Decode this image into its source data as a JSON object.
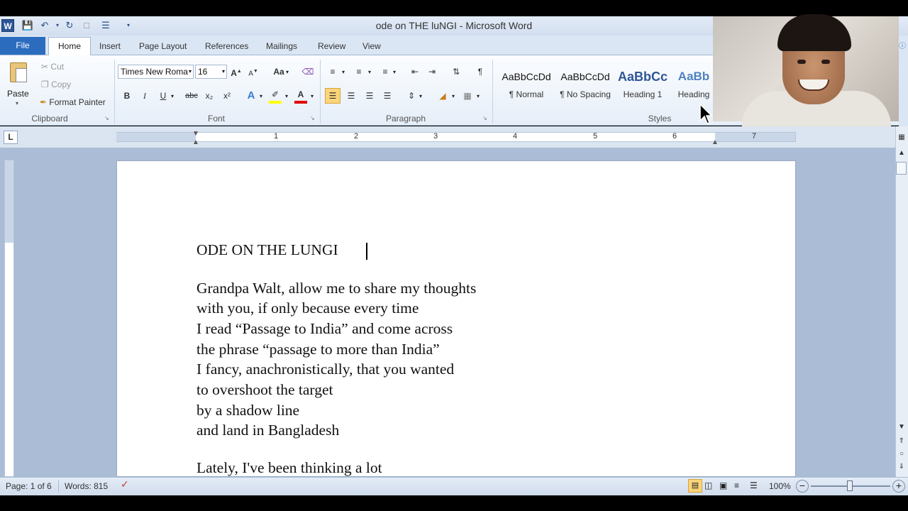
{
  "window": {
    "title": "ode on THE luNGI  -  Microsoft Word",
    "app_icon": "W"
  },
  "quick_access": [
    "save-icon",
    "undo-icon",
    "dropdown-icon",
    "redo-icon",
    "new-icon",
    "customize-icon",
    "more-icon"
  ],
  "tabs": [
    "File",
    "Home",
    "Insert",
    "Page Layout",
    "References",
    "Mailings",
    "Review",
    "View"
  ],
  "clipboard": {
    "paste": "Paste",
    "cut": "Cut",
    "copy": "Copy",
    "format_painter": "Format Painter",
    "label": "Clipboard"
  },
  "font": {
    "family": "Times New Roma",
    "size": "16",
    "label": "Font",
    "grow": "A",
    "shrink": "A",
    "case": "Aa",
    "bold": "B",
    "italic": "I",
    "underline": "U",
    "strike": "abc",
    "subscript": "x₂",
    "superscript": "x²",
    "text_effects": "A",
    "font_color": "A"
  },
  "paragraph": {
    "label": "Paragraph",
    "show_marks": "¶"
  },
  "styles": {
    "label": "Styles",
    "items": [
      {
        "sample": "AaBbCcDd",
        "name": "¶ Normal"
      },
      {
        "sample": "AaBbCcDd",
        "name": "¶ No Spacing"
      },
      {
        "sample": "AaBbCc",
        "name": "Heading 1"
      },
      {
        "sample": "AaBb",
        "name": "Heading"
      }
    ]
  },
  "ruler": {
    "numbers": [
      "1",
      "2",
      "3",
      "4",
      "5",
      "6",
      "7"
    ],
    "corner": "L"
  },
  "document": {
    "title_line": "ODE ON THE LUNGI",
    "lines": [
      "Grandpa Walt, allow me to share my thoughts",
      "with you, if only because every time",
      "I read “Passage to India” and come across",
      "the phrase “passage to more than India”",
      "I fancy, anachronistically, that you wanted",
      "to overshoot the target",
      "by a shadow line",
      "and land in Bangladesh"
    ],
    "next_stanza": "Lately, I've been thinking a lot"
  },
  "status": {
    "page": "Page: 1 of 6",
    "words": "Words: 815",
    "zoom": "100%"
  },
  "colors": {
    "file_tab": "#2b6cbf",
    "highlight": "#ffff00",
    "font_color": "#e00000"
  }
}
